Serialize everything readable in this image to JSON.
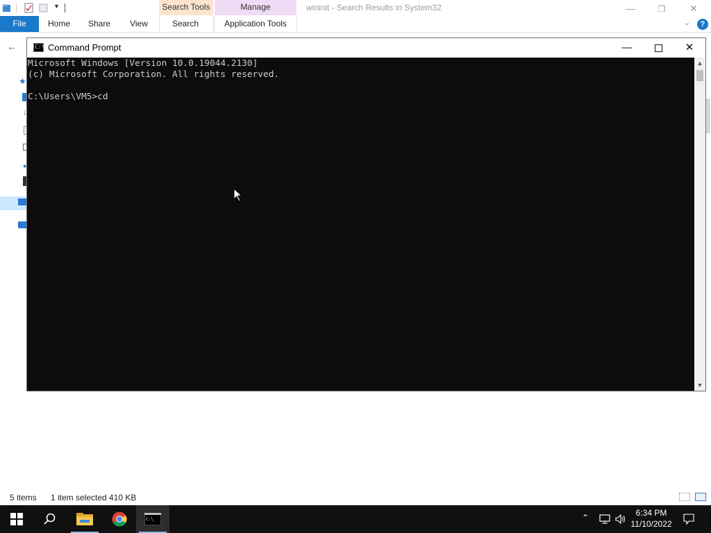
{
  "explorer": {
    "context_tabs": {
      "search_tools": "Search Tools",
      "manage": "Manage"
    },
    "window_title": "wininit - Search Results in System32",
    "ribbon_tabs": {
      "file": "File",
      "home": "Home",
      "share": "Share",
      "view": "View",
      "search": "Search",
      "application_tools": "Application Tools"
    },
    "status_bar": {
      "item_count": "5 items",
      "selection": "1 item selected",
      "size": "410 KB"
    },
    "accent_color": "#1979ca"
  },
  "cmd": {
    "title": "Command Prompt",
    "lines": [
      "Microsoft Windows [Version 10.0.19044.2130]",
      "(c) Microsoft Corporation. All rights reserved.",
      "",
      "C:\\Users\\VM5>cd"
    ],
    "buttons": {
      "minimize_icon": "minimize-icon",
      "maximize_icon": "maximize-icon",
      "close_icon": "close-icon"
    }
  },
  "taskbar": {
    "apps": [
      "windows-start",
      "search",
      "file-explorer",
      "chrome",
      "command-prompt"
    ],
    "clock": {
      "time": "6:34 PM",
      "date": "11/10/2022"
    }
  }
}
